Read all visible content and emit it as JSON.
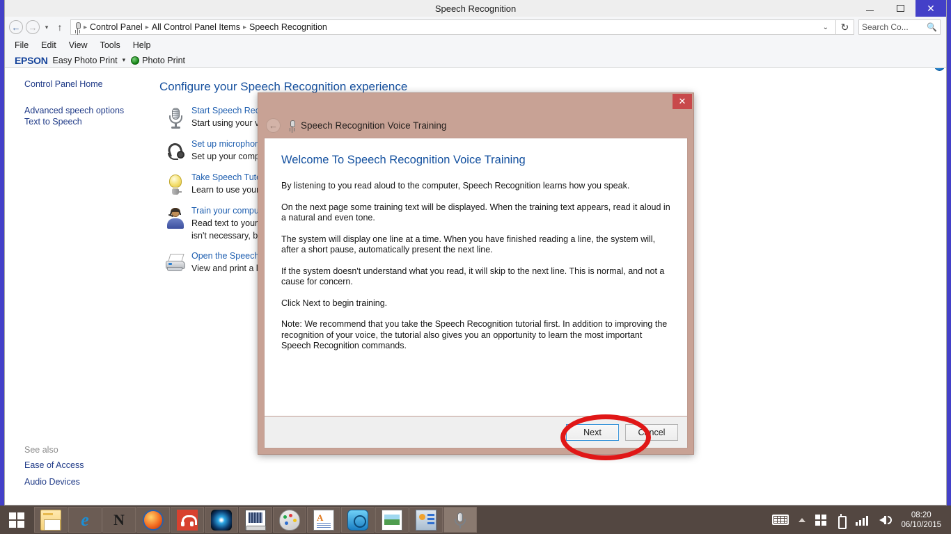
{
  "window": {
    "title": "Speech Recognition",
    "controls": {
      "minimize": "minimize-button",
      "maximize": "maximize-button",
      "close": "✕"
    }
  },
  "nav": {
    "back": "←",
    "forward": "→",
    "recent": "▾",
    "up": "↑",
    "breadcrumbs": [
      "Control Panel",
      "All Control Panel Items",
      "Speech Recognition"
    ],
    "separator": "▸",
    "dropdown": "⌄",
    "refresh": "↻"
  },
  "search": {
    "placeholder": "Search Co...",
    "value": "",
    "icon": "🔍"
  },
  "menubar": {
    "items": [
      "File",
      "Edit",
      "View",
      "Tools",
      "Help"
    ]
  },
  "epson_toolbar": {
    "logo": "EPSON",
    "easy_photo_print": "Easy Photo Print",
    "caret": "▾",
    "photo_print": "Photo Print"
  },
  "sidebar": {
    "home": "Control Panel Home",
    "links": [
      "Advanced speech options",
      "Text to Speech"
    ],
    "see_also_title": "See also",
    "see_also": [
      "Ease of Access",
      "Audio Devices"
    ]
  },
  "main": {
    "heading": "Configure your Speech Recognition experience",
    "help": "?",
    "tasks": [
      {
        "icon": "microphone-icon",
        "link": "Start Speech Recogn",
        "desc": "Start using your voi"
      },
      {
        "icon": "headset-icon",
        "link": "Set up microphone",
        "desc": "Set up your comput"
      },
      {
        "icon": "lightbulb-icon",
        "link": "Take Speech Tutoria",
        "desc": "Learn to use your co"
      },
      {
        "icon": "user-headset-icon",
        "link": "Train your compute",
        "desc": "Read text to your co\nisn't necessary, but "
      },
      {
        "icon": "printer-icon",
        "link": "Open the Speech Re",
        "desc": "View and print a list"
      }
    ]
  },
  "dialog": {
    "close": "✕",
    "back": "←",
    "title": "Speech Recognition Voice Training",
    "heading": "Welcome To Speech Recognition Voice Training",
    "paragraphs": [
      "By listening to you read aloud to the computer, Speech Recognition learns how you speak.",
      "On the next page some training text will be displayed. When the training text appears, read it aloud in a natural and even tone.",
      "The system will display one line at a time. When you have finished reading a line, the system will, after a short pause, automatically present the next line.",
      "If the system doesn't understand what you read, it will skip to the next line. This is normal, and not a cause for concern.",
      "Click Next to begin training.",
      "Note: We recommend that you take the Speech Recognition tutorial first. In addition to improving the recognition of your voice, the tutorial also gives you an opportunity to learn the most important Speech Recognition commands."
    ],
    "next_label": "Next",
    "cancel_label": "Cancel"
  },
  "annotation": {
    "shape": "red-ellipse",
    "color": "#e01717",
    "target": "Next"
  },
  "taskbar": {
    "start": "start-button",
    "tasks": [
      "folder-icon",
      "internet-explorer-icon",
      "nero-icon",
      "firefox-icon",
      "headphones-icon",
      "media-player-icon",
      "computer-icon",
      "paint-icon",
      "wordpad-icon",
      "disk-icon",
      "photo-viewer-icon",
      "control-panel-icon",
      "speech-recognition-icon"
    ],
    "tray": [
      "keyboard-icon",
      "show-hidden-icons-arrow",
      "windows-flag-icon",
      "usb-device-icon",
      "signal-bars-icon",
      "volume-icon"
    ],
    "clock_time": "08:20",
    "clock_date": "06/10/2015"
  }
}
